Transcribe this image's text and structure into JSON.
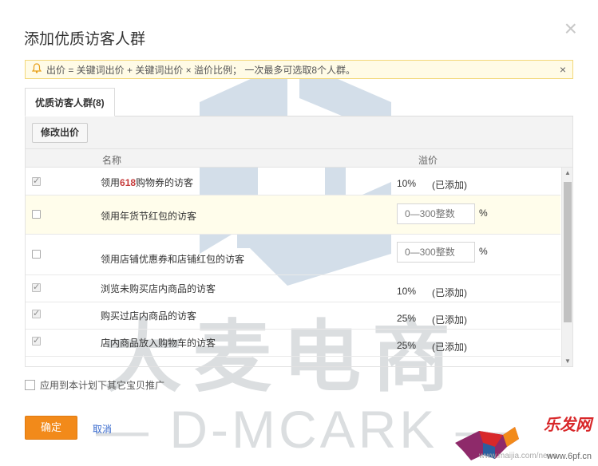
{
  "dialog": {
    "title": "添加优质访客人群",
    "close_symbol": "×"
  },
  "notice": {
    "icon": "bell-icon",
    "text": "出价 = 关键词出价 + 关键词出价 × 溢价比例； 一次最多可选取8个人群。",
    "close_symbol": "×"
  },
  "tabs": [
    {
      "label": "优质访客人群(8)",
      "active": true
    }
  ],
  "toolbar": {
    "edit_label": "修改出价"
  },
  "table": {
    "col_name": "名称",
    "col_price": "溢价",
    "rows": [
      {
        "name_pre": "领用",
        "name_hl": "618",
        "name_post": "购物券的访客",
        "checked": true,
        "pct": "10%",
        "status": "(已添加)"
      },
      {
        "name": "领用年货节红包的访客",
        "checked": false,
        "placeholder": "0—300整数",
        "unit": "%"
      },
      {
        "name": "领用店铺优惠券和店铺红包的访客",
        "checked": false,
        "placeholder": "0—300整数",
        "unit": "%"
      },
      {
        "name": "浏览未购买店内商品的访客",
        "checked": true,
        "pct": "10%",
        "status": "(已添加)"
      },
      {
        "name": "购买过店内商品的访客",
        "checked": true,
        "pct": "25%",
        "status": "(已添加)"
      },
      {
        "name": "店内商品放入购物车的访客",
        "checked": true,
        "pct": "25%",
        "status": "(已添加)"
      }
    ]
  },
  "apply_all": {
    "label": "应用到本计划下其它宝贝推广",
    "checked": false
  },
  "footer": {
    "ok_label": "确定",
    "cancel_label": "取消"
  },
  "watermark": {
    "big_text": "大麦电商",
    "sub_text": "— D-MCARK —",
    "corner_brand": "乐发网",
    "corner_url": "www.6pf.cn",
    "corner_url2": "www.maijia.com/news"
  },
  "colors": {
    "primary_button": "#f28a1a",
    "link": "#3366cc",
    "notice_bg": "#fffbe6",
    "highlight_number": "#c63b3b"
  }
}
